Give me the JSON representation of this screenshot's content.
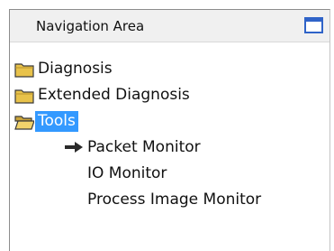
{
  "panel": {
    "title": "Navigation Area"
  },
  "tree": {
    "items": [
      {
        "label": "Diagnosis",
        "icon": "folder-closed-icon"
      },
      {
        "label": "Extended Diagnosis",
        "icon": "folder-closed-icon"
      },
      {
        "label": "Tools",
        "icon": "folder-open-icon",
        "selected": true
      },
      {
        "label": "Packet Monitor",
        "icon": "arrow-right-icon"
      },
      {
        "label": "IO Monitor"
      },
      {
        "label": "Process Image Monitor"
      }
    ]
  },
  "colors": {
    "selection": "#3399ff",
    "window_icon": "#2f63c8",
    "folder": "#e8c24a"
  }
}
